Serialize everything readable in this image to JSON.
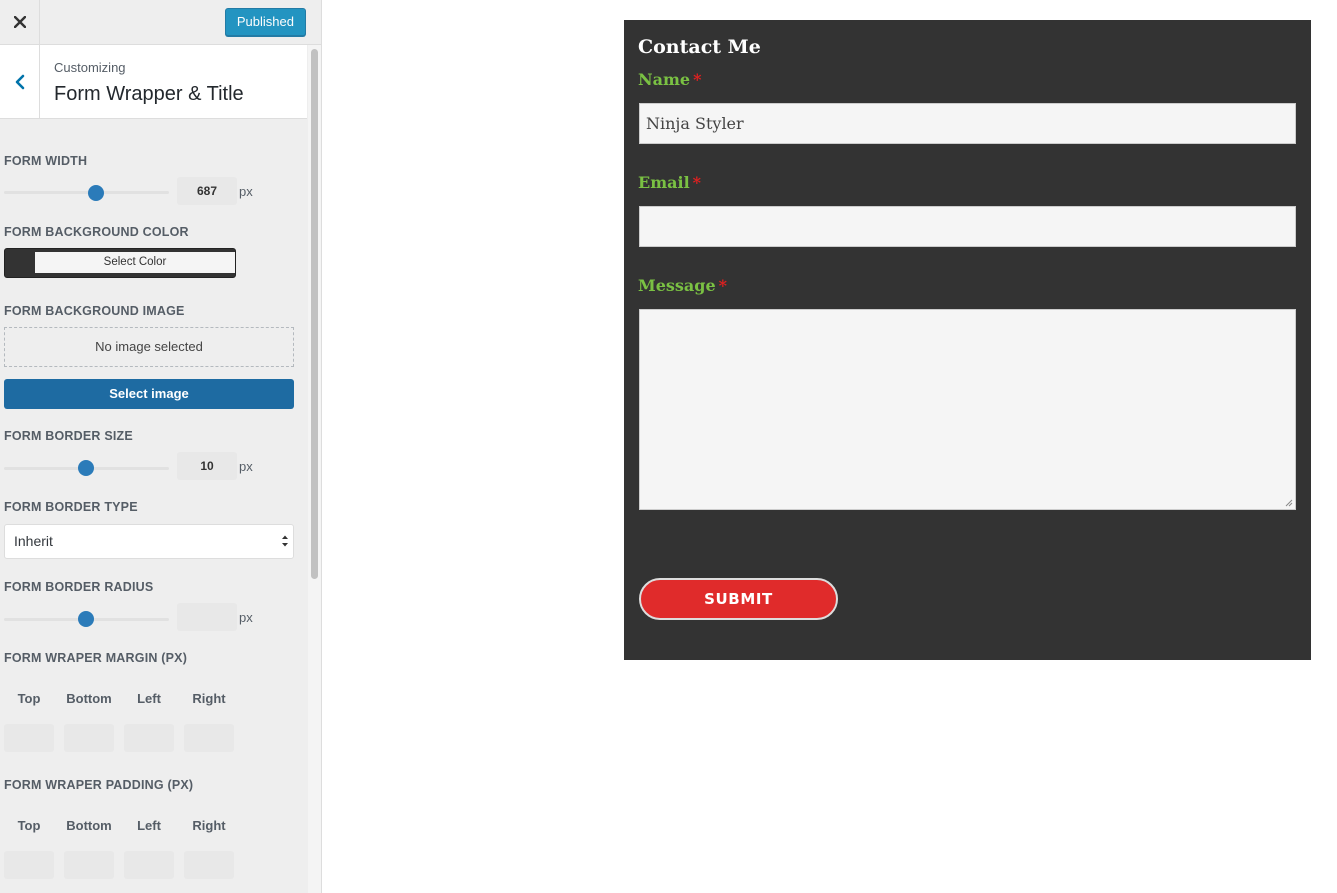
{
  "header": {
    "publish_label": "Published"
  },
  "section": {
    "parent_label": "Customizing",
    "title": "Form Wrapper & Title"
  },
  "controls": {
    "form_width": {
      "label": "FORM WIDTH",
      "value": "687",
      "unit": "px",
      "slider_fraction": 0.55
    },
    "form_bg_color": {
      "label": "FORM BACKGROUND COLOR",
      "button_label": "Select Color",
      "swatch_color": "#333333"
    },
    "form_bg_image": {
      "label": "FORM BACKGROUND IMAGE",
      "placeholder": "No image selected",
      "button_label": "Select image"
    },
    "form_border_size": {
      "label": "FORM BORDER SIZE",
      "value": "10",
      "unit": "px",
      "slider_fraction": 0.5
    },
    "form_border_type": {
      "label": "FORM BORDER TYPE",
      "selected": "Inherit"
    },
    "form_border_radius": {
      "label": "FORM BORDER RADIUS",
      "value": "",
      "unit": "px",
      "slider_fraction": 0.5
    },
    "form_margin": {
      "label": "FORM WRAPER MARGIN (PX)",
      "sides": [
        "Top",
        "Bottom",
        "Left",
        "Right"
      ]
    },
    "form_padding": {
      "label": "FORM WRAPER PADDING (PX)",
      "sides": [
        "Top",
        "Bottom",
        "Left",
        "Right"
      ]
    }
  },
  "preview": {
    "title": "Contact Me",
    "fields": [
      {
        "label": "Name",
        "required_mark": "*",
        "value": "Ninja Styler"
      },
      {
        "label": "Email",
        "required_mark": "*",
        "value": ""
      },
      {
        "label": "Message",
        "required_mark": "*",
        "value": ""
      }
    ],
    "submit_label": "SUBMIT",
    "colors": {
      "background": "#333333",
      "label": "#7ac143",
      "required": "#e02020",
      "submit": "#e02b2b"
    }
  },
  "icons": {
    "close": "close-icon",
    "back": "chevron-left-icon",
    "select_arrows": "select-arrows-icon"
  }
}
